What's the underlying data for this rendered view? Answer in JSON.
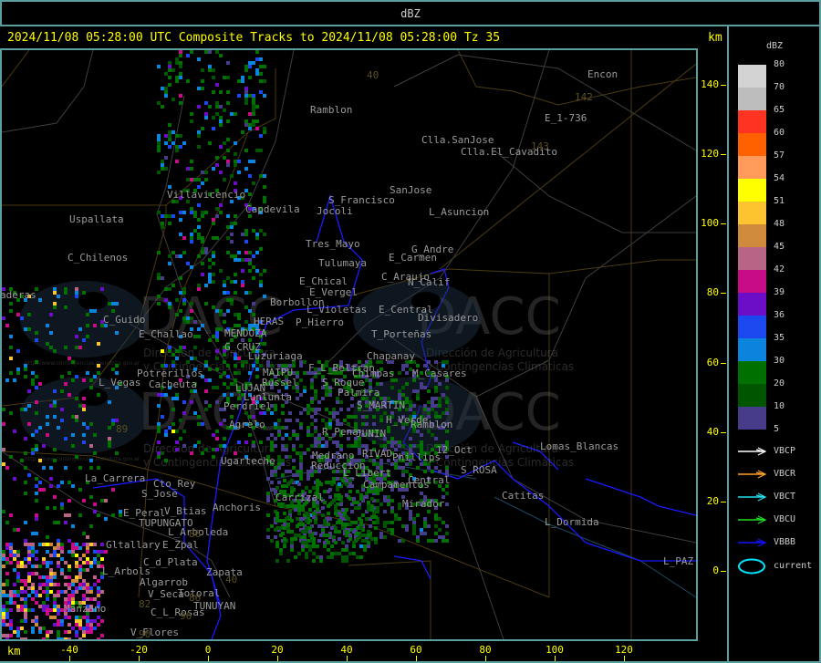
{
  "window_title": "dBZ",
  "header": {
    "title": "2024/11/08 05:28:00 UTC Composite Tracks to 2024/11/08 05:28:00 Tz 35",
    "unit": "km"
  },
  "legend": {
    "title": "dBZ",
    "scale": [
      {
        "label": "80",
        "color": "#d3d3d3"
      },
      {
        "label": "70",
        "color": "#bdbdbd"
      },
      {
        "label": "65",
        "color": "#ff3322"
      },
      {
        "label": "60",
        "color": "#ff6000"
      },
      {
        "label": "57",
        "color": "#ff9a5a"
      },
      {
        "label": "54",
        "color": "#ffff00"
      },
      {
        "label": "51",
        "color": "#fcc530"
      },
      {
        "label": "48",
        "color": "#d08a3c"
      },
      {
        "label": "45",
        "color": "#b86486"
      },
      {
        "label": "42",
        "color": "#c80c88"
      },
      {
        "label": "39",
        "color": "#6c0ec8"
      },
      {
        "label": "36",
        "color": "#1c48f0"
      },
      {
        "label": "35",
        "color": "#0a84dc"
      },
      {
        "label": "30",
        "color": "#007000"
      },
      {
        "label": "20",
        "color": "#005600"
      },
      {
        "label": "10",
        "color": "#463c8a"
      },
      {
        "label": "5",
        "color": null
      }
    ],
    "tracks": [
      {
        "label": "VBCP",
        "color": "#ffffff"
      },
      {
        "label": "VBCR",
        "color": "#ffa020"
      },
      {
        "label": "VBCT",
        "color": "#20e0f0"
      },
      {
        "label": "VBCU",
        "color": "#20e020"
      },
      {
        "label": "VBBB",
        "color": "#1010ff"
      }
    ],
    "current": {
      "label": "current",
      "color": "#00e5ff"
    }
  },
  "axes": {
    "x_unit": "km",
    "x_ticks": [
      "-40",
      "-20",
      "0",
      "20",
      "40",
      "60",
      "80",
      "100",
      "120"
    ],
    "y_ticks": [
      "140",
      "120",
      "100",
      "80",
      "60",
      "40",
      "20",
      "0"
    ]
  },
  "places": [
    "Ramblon",
    "Encon",
    "E_1-736",
    "Clla.SanJose",
    "Clla.El_Cavadito",
    "SanJose",
    "S_Francisco",
    "Jocoli",
    "L_Asuncion",
    "Villavicencio",
    "Capdevila",
    "Uspallata",
    "Tres_Mayo",
    "G_Andre",
    "E_Carmen",
    "Tulumaya",
    "C_Chilenos",
    "C_Araujo",
    "N_Calif",
    "E_Chical",
    "E_Vergel",
    "Borbollon",
    "L_Violetas",
    "E_Central",
    "Divisadero",
    "aderas",
    "C_Guido",
    "HERAS",
    "P_Hierro",
    "E_Challao",
    "MENDOZA",
    "T_Porteñas",
    "G_CRUZ",
    "Luzuriaga",
    "Chapanay",
    "F_L_Beltran",
    "Potrerillos",
    "MAIPU",
    "Chimbas",
    "M_Casares",
    "L_Vegas",
    "Cacheuta",
    "Russel",
    "S_Roque",
    "LUJAN",
    "Lunlunta",
    "Palmira",
    "Perdriel",
    "S_MARTIN",
    "Agrelo",
    "H_Verde",
    "Ramblon",
    "R_Pena",
    "JUNIN",
    "12_Oct",
    "Lomas_Blancas",
    "Medrano",
    "RIVAD",
    "Phillips",
    "Ugarteche",
    "Reduccion",
    "S_ROSA",
    "L_Libert",
    "La_Carrera",
    "Central",
    "Cto_Rey",
    "Campamentos",
    "S_Jose",
    "Catitas",
    "Carrizal",
    "Mirador",
    "Anchoris",
    "E_Peral",
    "V_Btias",
    "TUPUNGATO",
    "L_Dormida",
    "L_Arboleda",
    "Gltallary",
    "E_Zpal",
    "C_d_Plata",
    "Zapata",
    "L_Arbols",
    "Algarrob",
    "V_Seca",
    "Totoral",
    "L_PAZ",
    "TUNUYAN",
    "Manzano",
    "C_L_Rosas",
    "V_Flores"
  ],
  "route_numbers": [
    "40",
    "142",
    "143",
    "40",
    "86",
    "82",
    "96",
    "90",
    "94",
    "40",
    "98",
    "89",
    "86"
  ],
  "watermark": {
    "logo": "DACC",
    "line1": "Dirección de Agricultura",
    "line2": "y Contingencias Climáticas",
    "url": "http://www.contingencias.mendoza.gov.ar"
  }
}
